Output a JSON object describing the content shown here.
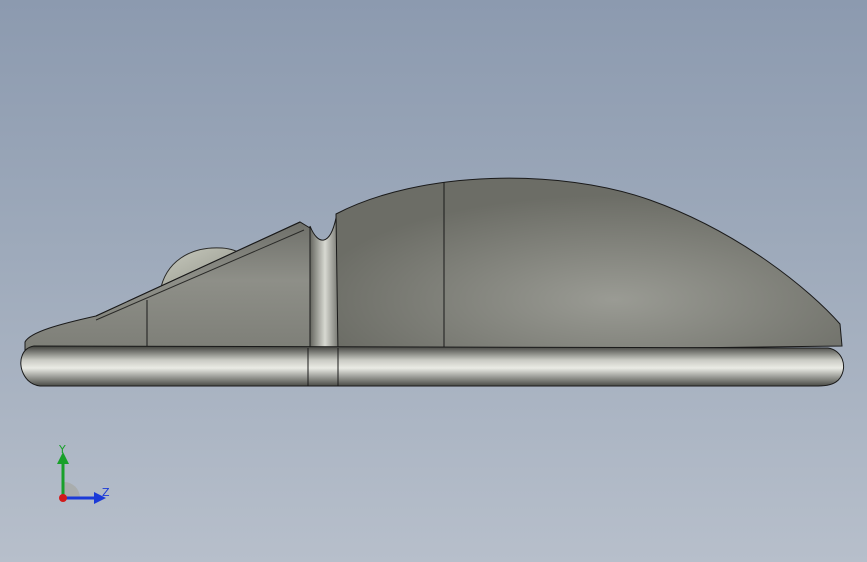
{
  "viewport": {
    "background_top": "#8c9aaf",
    "background_bottom": "#b7bfcb"
  },
  "model": {
    "icon": "computer-mouse-3d-model",
    "shading_color": "#8a8b84",
    "edge_color": "#1a1a1a"
  },
  "triad": {
    "y_label": "Y",
    "z_label": "Z",
    "y_color": "#18a02a",
    "z_color": "#1b3ad8",
    "x_color": "#d11a1a"
  }
}
